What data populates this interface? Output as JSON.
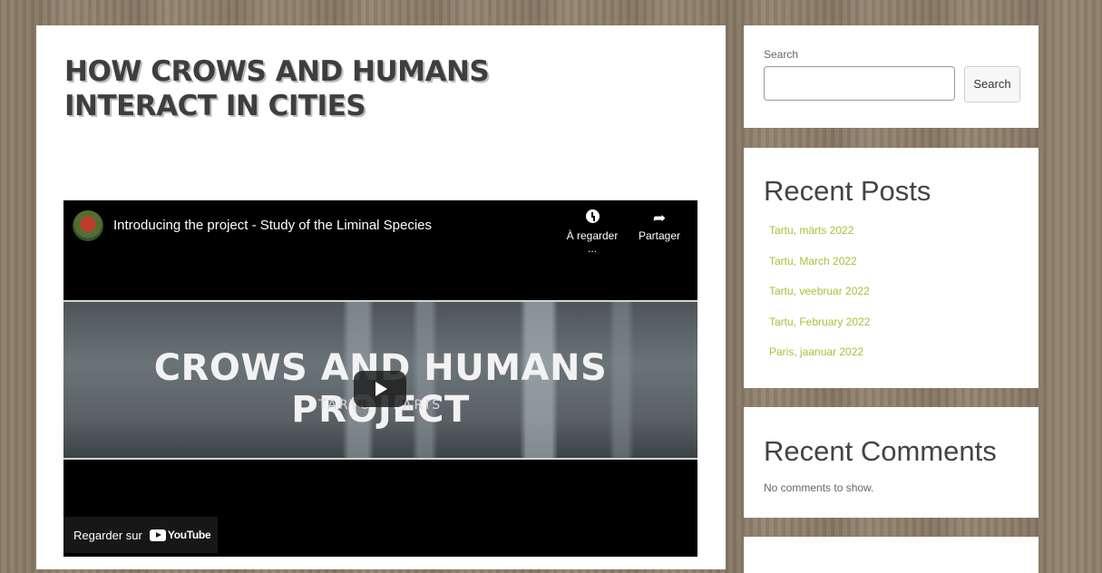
{
  "post": {
    "title": "HOW CROWS AND HUMANS INTERACT IN CITIES"
  },
  "video": {
    "title": "Introducing the project - Study of the Liminal Species",
    "watch_later_label": "À regarder ...",
    "share_label": "Partager",
    "banner_title": "CROWS AND HUMANS PROJECT",
    "banner_subtitle": "TARTU - PARIS",
    "watch_on_label": "Regarder sur",
    "youtube_label": "YouTube"
  },
  "sidebar": {
    "search": {
      "label": "Search",
      "button_label": "Search",
      "value": ""
    },
    "recent_posts": {
      "title": "Recent Posts",
      "items": [
        {
          "label": "Tartu, märts 2022"
        },
        {
          "label": "Tartu, March 2022"
        },
        {
          "label": "Tartu, veebruar 2022"
        },
        {
          "label": "Tartu, February 2022"
        },
        {
          "label": "Paris, jaanuar 2022"
        }
      ]
    },
    "recent_comments": {
      "title": "Recent Comments",
      "empty_text": "No comments to show."
    }
  },
  "colors": {
    "link": "#a6c23a",
    "heading": "#3e3e3e",
    "background": "#8f7f6b"
  }
}
